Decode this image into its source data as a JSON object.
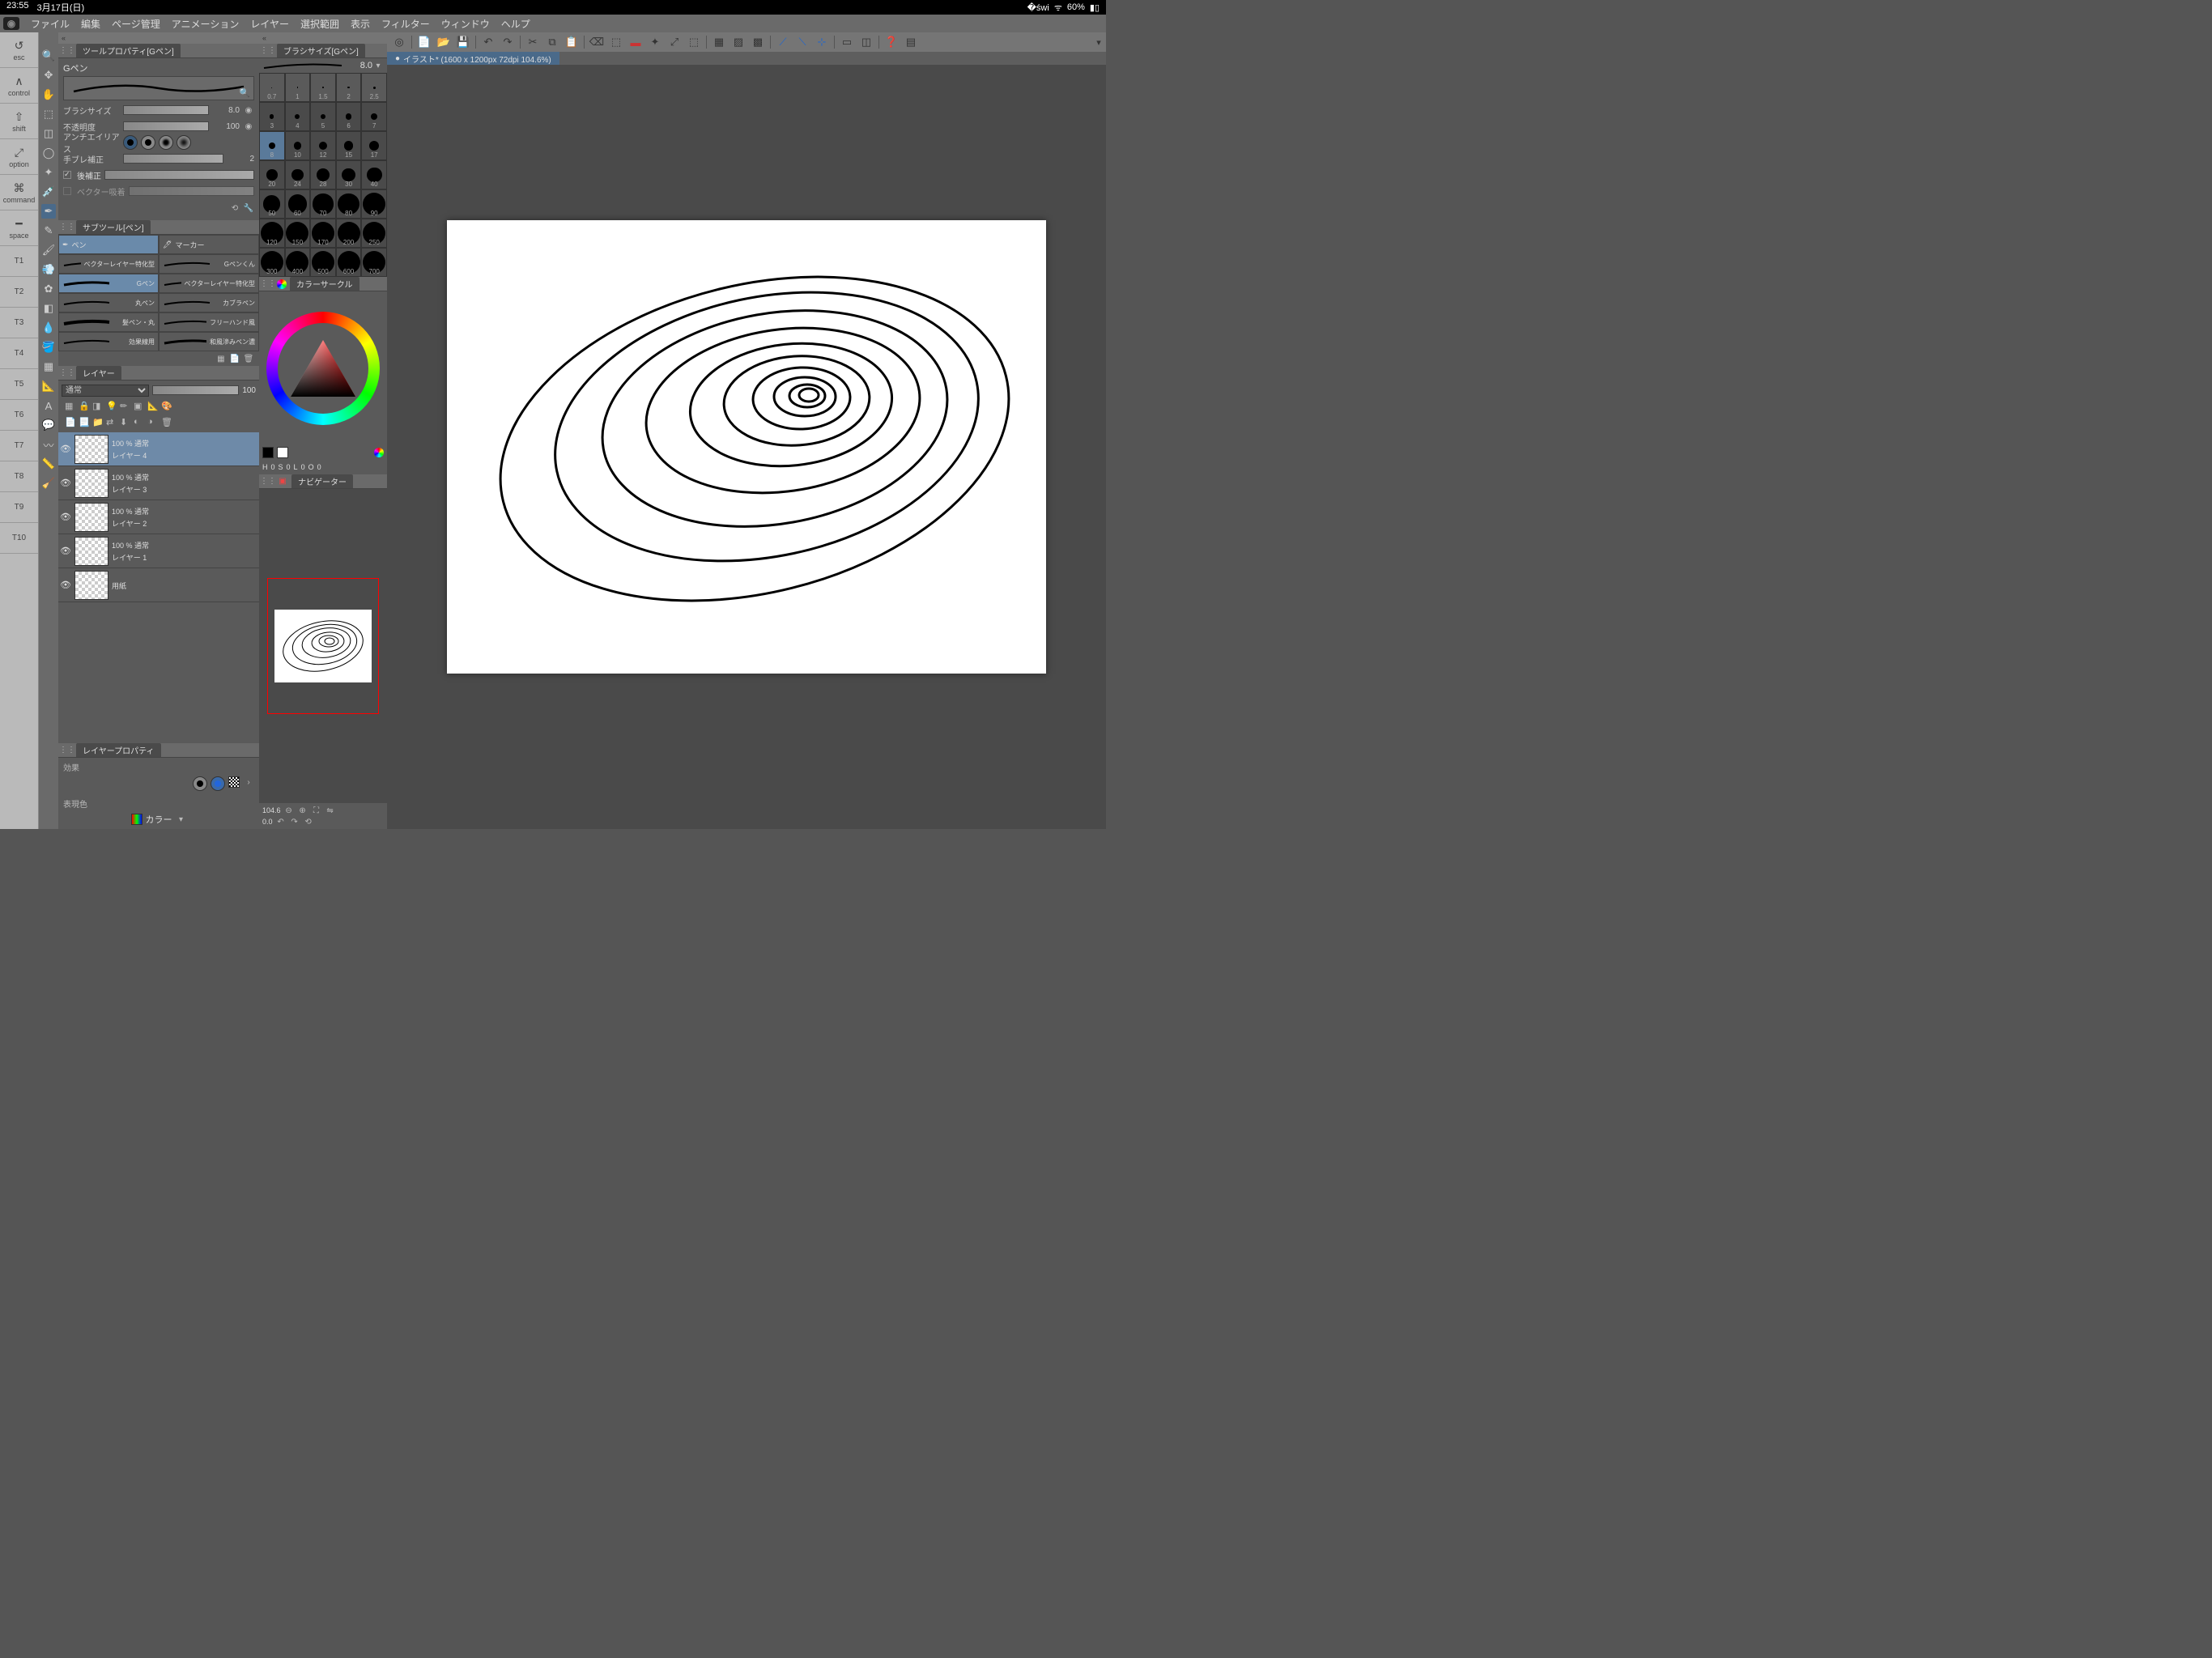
{
  "status": {
    "time": "23:55",
    "date": "3月17日(日)",
    "battery": "60%"
  },
  "menu": [
    "ファイル",
    "編集",
    "ページ管理",
    "アニメーション",
    "レイヤー",
    "選択範囲",
    "表示",
    "フィルター",
    "ウィンドウ",
    "ヘルプ"
  ],
  "edge": {
    "mods": [
      {
        "icon": "↺",
        "label": "esc"
      },
      {
        "icon": "∧",
        "label": "control"
      },
      {
        "icon": "⇧",
        "label": "shift"
      },
      {
        "icon": "↘",
        "label": "option"
      },
      {
        "icon": "⌘",
        "label": "command"
      },
      {
        "icon": "━",
        "label": "space"
      }
    ],
    "t": [
      "T1",
      "T2",
      "T3",
      "T4",
      "T5",
      "T6",
      "T7",
      "T8",
      "T9",
      "T10"
    ]
  },
  "toolProp": {
    "title": "ツールプロパティ[Gペン]",
    "brushName": "Gペン",
    "rows": [
      {
        "label": "ブラシサイズ",
        "val": "8.0"
      },
      {
        "label": "不透明度",
        "val": "100"
      }
    ],
    "aa": "アンチエイリアス",
    "stab": "手ブレ補正",
    "stabVal": "2",
    "postCorrect": "後補正",
    "vectorSnap": "ベクター吸着"
  },
  "subtool": {
    "title": "サブツール[ペン]",
    "groups": [
      "ペン",
      "マーカー"
    ],
    "items": [
      "ベクターレイヤー特化型",
      "Gペンくん",
      "Gペン",
      "ベクターレイヤー特化型",
      "丸ペン",
      "カブラペン",
      "髪ペン・丸",
      "フリーハンド風",
      "効果線用",
      "和風滲みペン濃"
    ]
  },
  "layerPanel": {
    "title": "レイヤー",
    "blend": "通常",
    "opacity": "100",
    "layers": [
      {
        "opacity": "100 % 通常",
        "name": "レイヤー 4",
        "sel": true
      },
      {
        "opacity": "100 % 通常",
        "name": "レイヤー 3",
        "sel": false
      },
      {
        "opacity": "100 % 通常",
        "name": "レイヤー 2",
        "sel": false
      },
      {
        "opacity": "100 % 通常",
        "name": "レイヤー 1",
        "sel": false
      },
      {
        "opacity": "",
        "name": "用紙",
        "sel": false
      }
    ]
  },
  "layerProp": {
    "title": "レイヤープロパティ",
    "effect": "効果",
    "expr": "表現色",
    "exprVal": "カラー"
  },
  "brushSize": {
    "title": "ブラシサイズ[Gペン]",
    "current": "8.0",
    "head": [
      "0.7",
      "1",
      "1.5",
      "2",
      "2.5"
    ],
    "rows": [
      [
        "3",
        "4",
        "5",
        "6",
        "7"
      ],
      [
        "8",
        "10",
        "12",
        "15",
        "17"
      ],
      [
        "20",
        "24",
        "28",
        "30",
        "40"
      ],
      [
        "50",
        "60",
        "70",
        "80",
        "90"
      ],
      [
        "120",
        "150",
        "170",
        "200",
        "250"
      ],
      [
        "300",
        "400",
        "500",
        "600",
        "700"
      ]
    ],
    "selected": "8"
  },
  "colorCircle": {
    "title": "カラーサークル",
    "h": "H",
    "hv": "0",
    "s": "S",
    "sv": "0",
    "l": "L",
    "lv": "0",
    "o": "O",
    "ov": "0"
  },
  "navigator": {
    "title": "ナビゲーター",
    "zoom": "104.6",
    "rot": "0.0"
  },
  "doc": {
    "tab": "イラスト* (1600 x 1200px 72dpi 104.6%)"
  }
}
